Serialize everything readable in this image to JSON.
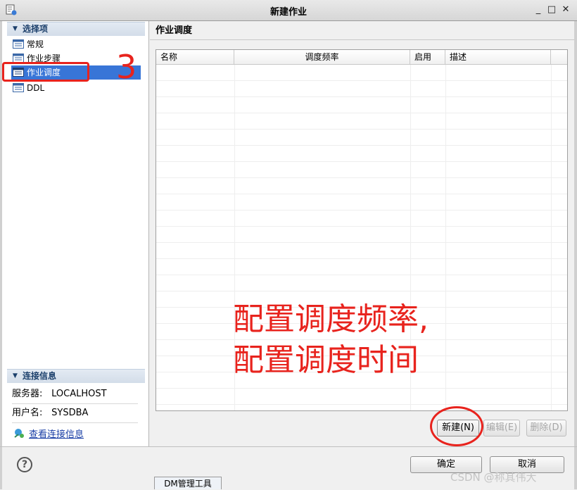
{
  "window": {
    "title": "新建作业",
    "icon": "dm-app-icon",
    "controls": [
      "minimize-icon",
      "maximize-icon",
      "close-icon"
    ],
    "control_glyphs": [
      "_",
      "□",
      "✕"
    ]
  },
  "sidebar": {
    "section_title": "选择项",
    "items": [
      {
        "label": "常规",
        "icon": "table-icon"
      },
      {
        "label": "作业步骤",
        "icon": "table-icon"
      },
      {
        "label": "作业调度",
        "icon": "table-icon",
        "selected": true
      },
      {
        "label": "DDL",
        "icon": "table-icon"
      }
    ],
    "annotation_number": "3"
  },
  "connection": {
    "section_title": "连接信息",
    "server_label": "服务器:",
    "server_value": "LOCALHOST",
    "user_label": "用户名:",
    "user_value": "SYSDBA",
    "view_link": "查看连接信息"
  },
  "main": {
    "page_title": "作业调度",
    "table": {
      "columns": [
        "名称",
        "调度频率",
        "启用",
        "描述"
      ],
      "rows": []
    },
    "buttons": {
      "new": "新建(N)",
      "edit": "编辑(E)",
      "delete": "删除(D)"
    },
    "annotation_lines": [
      "配置调度频率,",
      "配置调度时间"
    ]
  },
  "footer": {
    "ok": "确定",
    "cancel": "取消",
    "help_glyph": "?"
  },
  "taskbar": {
    "tab_label": "DM管理工具"
  },
  "watermark": "CSDN @称其伟大",
  "colors": {
    "selection": "#3875d7",
    "annotation_red": "#e8231d",
    "link_blue": "#1a3fa6",
    "section_header_text": "#1b3f6b"
  }
}
